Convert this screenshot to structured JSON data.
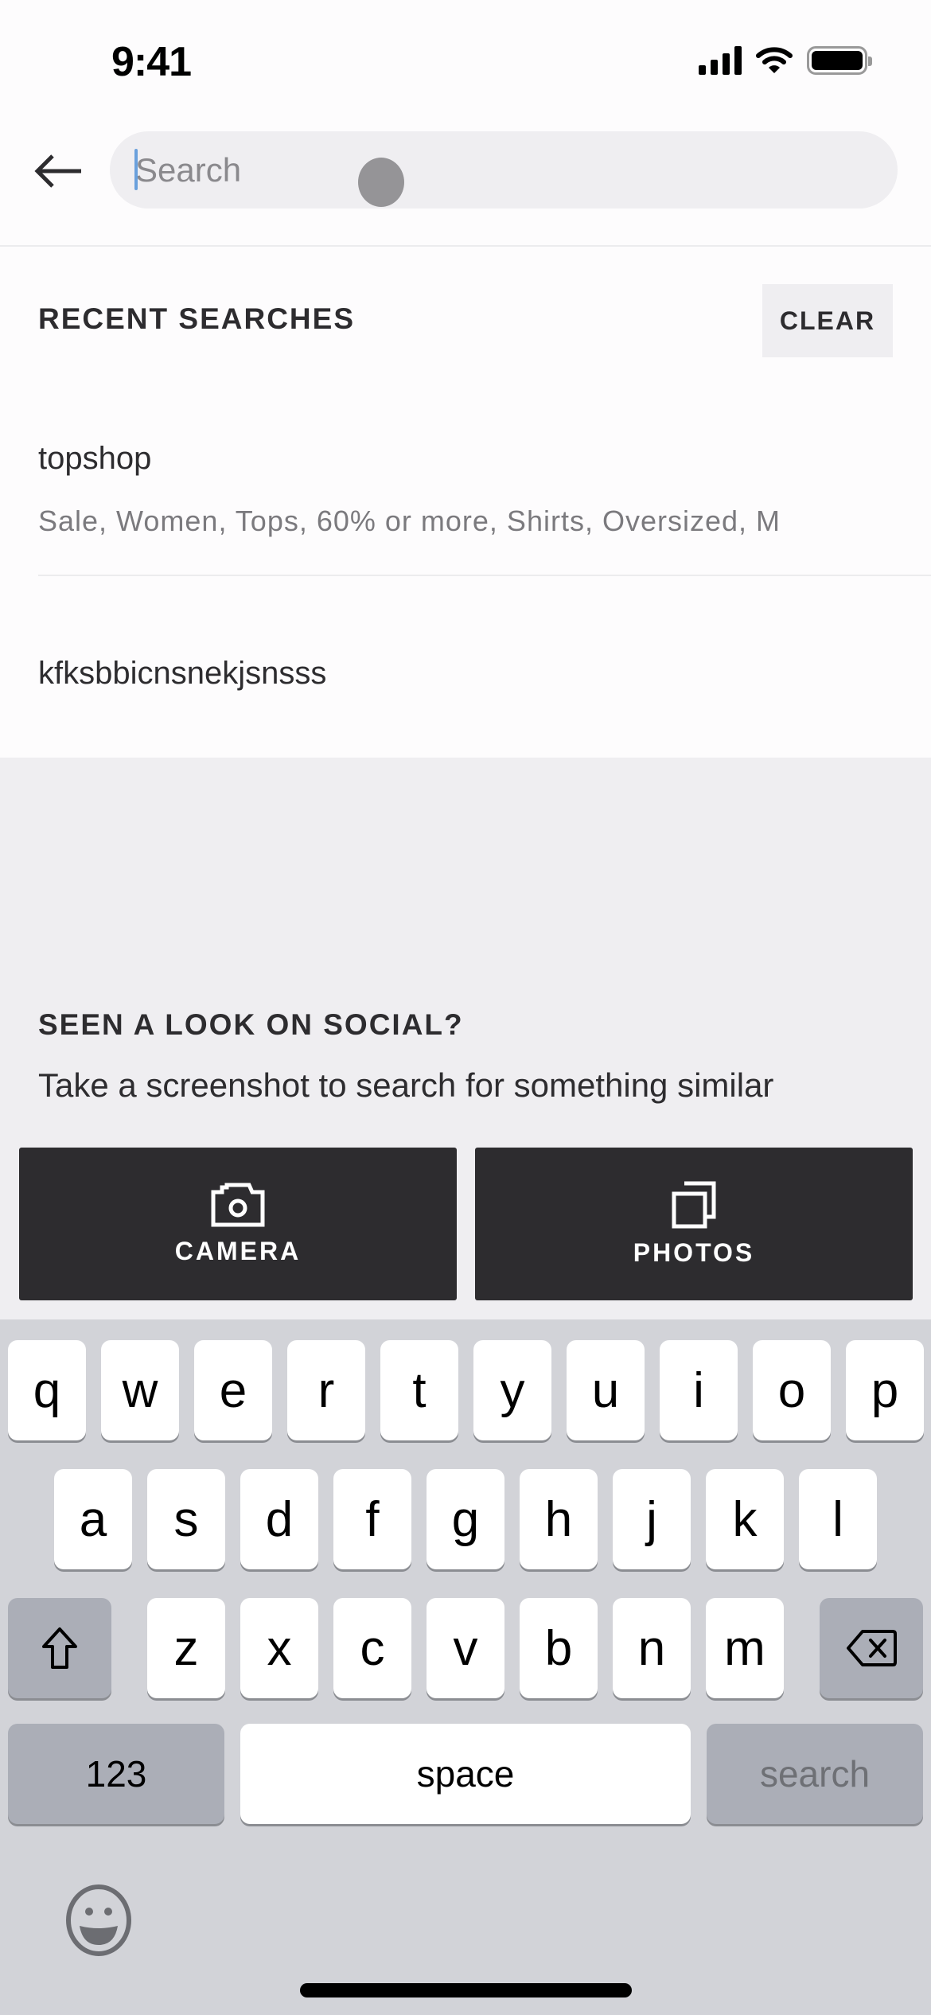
{
  "status_bar": {
    "time": "9:41",
    "icons": [
      "cellular-signal-icon",
      "wifi-icon",
      "battery-icon"
    ]
  },
  "search": {
    "placeholder": "Search",
    "value": "",
    "back_icon": "arrow-left-icon"
  },
  "recent_searches": {
    "title": "RECENT SEARCHES",
    "clear_label": "CLEAR",
    "items": [
      {
        "query": "topshop",
        "filters": "Sale, Women, Tops, 60% or more, Shirts, Oversized, M"
      },
      {
        "query": "kfksbbicnsnekjsnsss",
        "filters": ""
      }
    ]
  },
  "social": {
    "title": "SEEN A LOOK ON SOCIAL?",
    "subtitle": "Take a screenshot to search for something similar",
    "buttons": [
      {
        "label": "CAMERA",
        "icon": "camera-icon"
      },
      {
        "label": "PHOTOS",
        "icon": "photos-icon"
      }
    ]
  },
  "keyboard": {
    "row1": [
      "q",
      "w",
      "e",
      "r",
      "t",
      "y",
      "u",
      "i",
      "o",
      "p"
    ],
    "row2": [
      "a",
      "s",
      "d",
      "f",
      "g",
      "h",
      "j",
      "k",
      "l"
    ],
    "row3": [
      "z",
      "x",
      "c",
      "v",
      "b",
      "n",
      "m"
    ],
    "shift_icon": "shift-icon",
    "delete_icon": "backspace-icon",
    "numbers_label": "123",
    "space_label": "space",
    "return_label": "search",
    "emoji_icon": "emoji-icon"
  },
  "colors": {
    "text_primary": "#2d2c2f",
    "text_secondary": "#7b7a7e",
    "surface_light": "#efeef1",
    "button_dark": "#2d2c2f",
    "keyboard_bg": "#d2d3d8",
    "key_dark": "#abaeb7",
    "caret": "#6aa0dc"
  }
}
